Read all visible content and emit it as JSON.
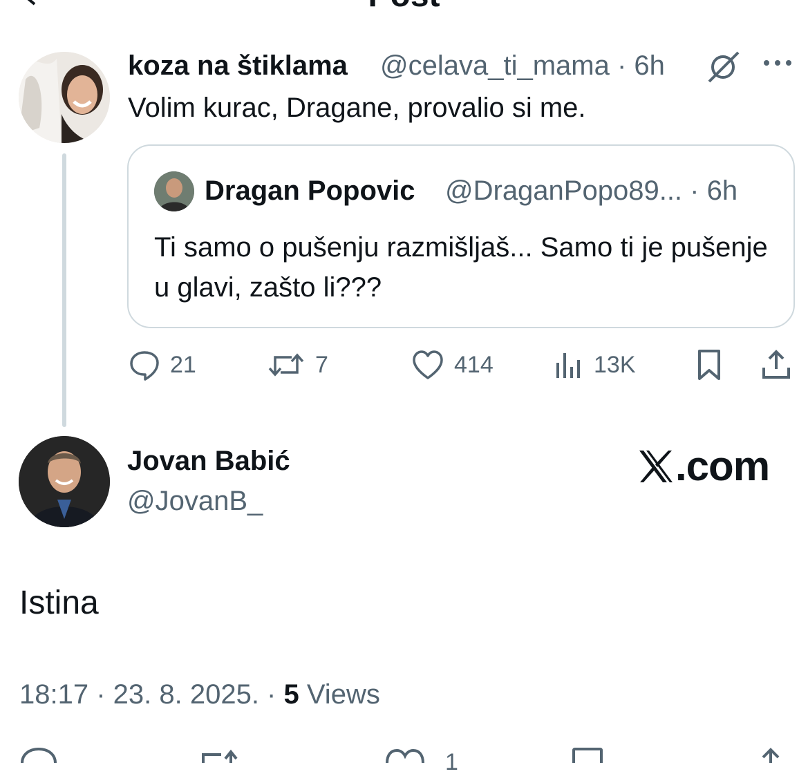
{
  "header": {
    "title": "Post"
  },
  "tweet": {
    "author_name": "koza na štiklama",
    "handle_time": "@celava_ti_mama · 6h",
    "text": "Volim kurac, Dragane, provalio si me.",
    "quote": {
      "author_name": "Dragan Popovic",
      "handle_time": "@DraganPopo89... · 6h",
      "text": "Ti samo o pušenju razmišljaš... Samo ti je pušenje u glavi, zašto li???"
    },
    "actions": {
      "replies": "21",
      "reposts": "7",
      "likes": "414",
      "views": "13K"
    }
  },
  "reply": {
    "author_name": "Jovan Babić",
    "handle": "@JovanB_",
    "watermark": ".com",
    "text": "Istina",
    "meta": {
      "time_date": "18:17 · 23. 8. 2025. · ",
      "views_count": "5",
      "views_label": " Views"
    },
    "actions": {
      "likes": "1"
    }
  },
  "colors": {
    "text": "#0f1419",
    "secondary": "#536471",
    "border": "#cfd9de"
  }
}
